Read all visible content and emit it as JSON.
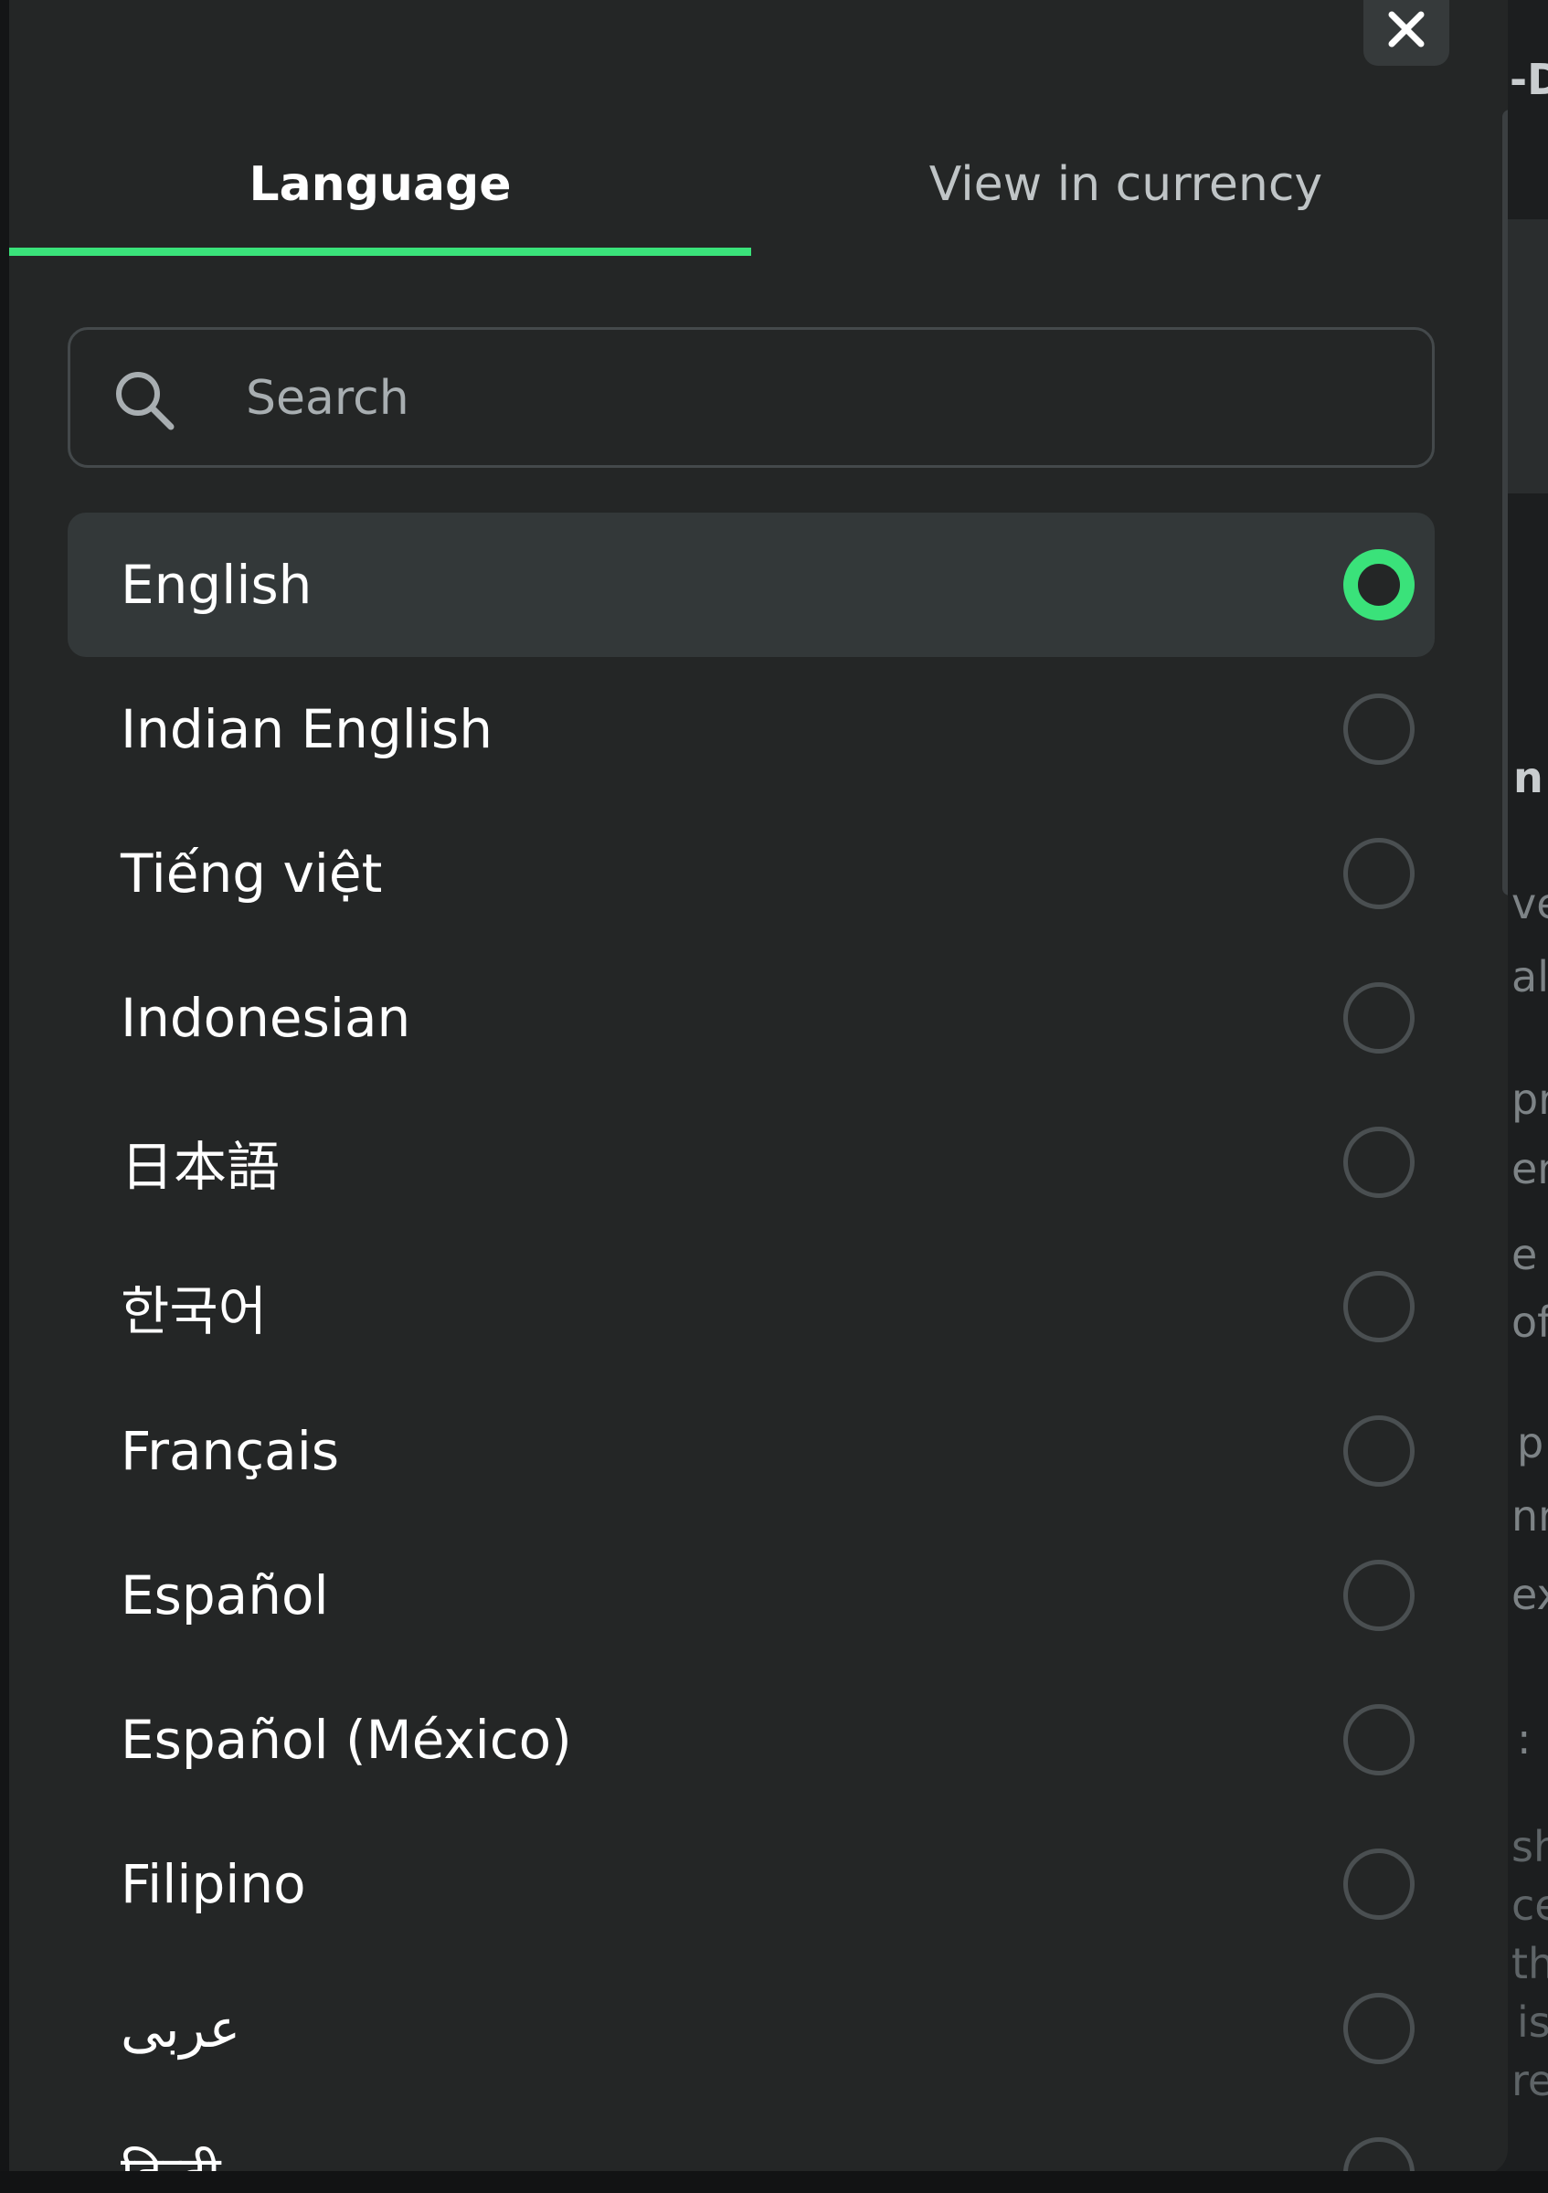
{
  "modal": {
    "close_label": "✕"
  },
  "tabs": [
    {
      "label": "Language",
      "active": true
    },
    {
      "label": "View in currency",
      "active": false
    }
  ],
  "search": {
    "placeholder": "Search",
    "value": ""
  },
  "languages": [
    {
      "label": "English",
      "selected": true
    },
    {
      "label": "Indian English",
      "selected": false
    },
    {
      "label": "Tiếng việt",
      "selected": false
    },
    {
      "label": "Indonesian",
      "selected": false
    },
    {
      "label": "日本語",
      "selected": false
    },
    {
      "label": "한국어",
      "selected": false
    },
    {
      "label": "Français",
      "selected": false
    },
    {
      "label": "Español",
      "selected": false
    },
    {
      "label": "Español (México)",
      "selected": false
    },
    {
      "label": "Filipino",
      "selected": false
    },
    {
      "label": "عربى",
      "selected": false
    },
    {
      "label": "हिन्दी",
      "selected": false
    }
  ],
  "background_text": [
    "-D",
    "n",
    "ve",
    "al",
    "pro",
    "en",
    "e g",
    "of",
    "p",
    "nn",
    "ex",
    ":",
    "sh",
    "ce",
    "the",
    "is",
    "rel"
  ],
  "colors": {
    "accent": "#3ae27a",
    "panel": "#242626",
    "selected_row": "#333839"
  }
}
